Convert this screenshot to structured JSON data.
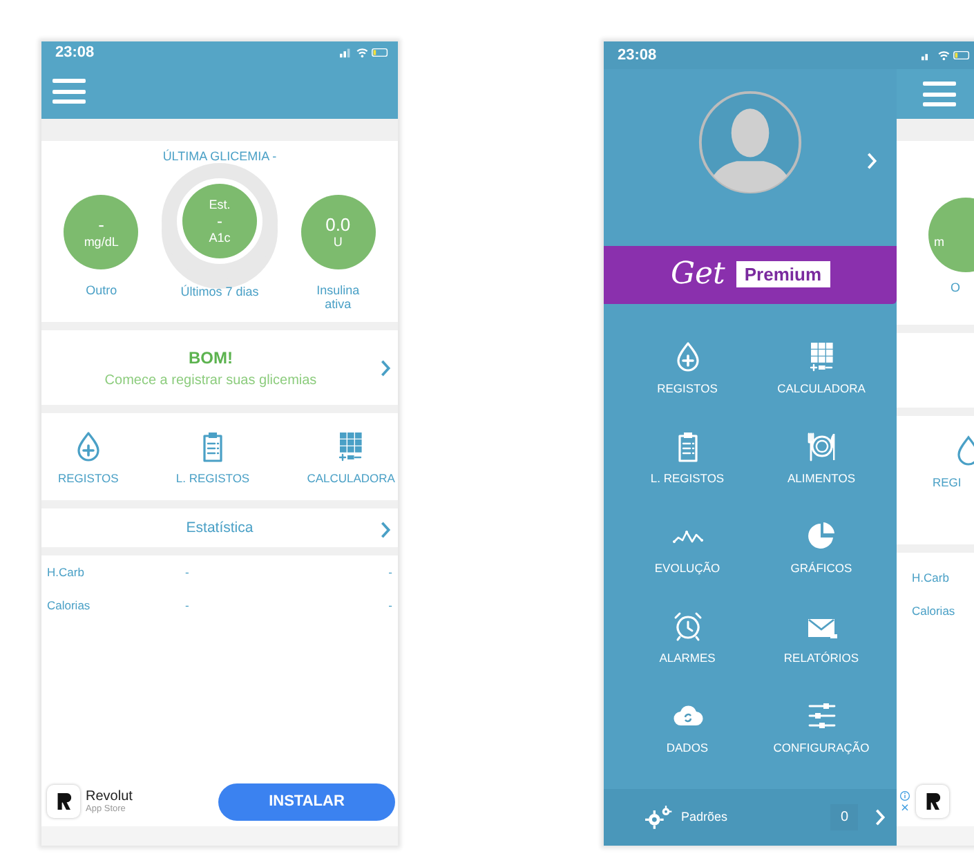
{
  "home_screen": {
    "status_bar": {
      "time": "23:08"
    },
    "last_reading": {
      "title": "ÚLTIMA GLICEMIA -"
    },
    "stats": [
      {
        "kind": "circle",
        "value": "-",
        "unit": "mg/dL",
        "label": "Outro"
      },
      {
        "kind": "ring",
        "top": "Est.",
        "value": "-",
        "unit": "A1c",
        "label": "Últimos 7 dias"
      },
      {
        "kind": "circle",
        "value": "0.0",
        "unit": "U",
        "label": "Insulina ativa"
      }
    ],
    "status_card": {
      "title": "BOM!",
      "subtitle": "Comece a registrar suas glicemias"
    },
    "shortcuts": [
      {
        "kind": "drop",
        "label": "REGISTOS"
      },
      {
        "kind": "clipboard",
        "label": "L. REGISTOS"
      },
      {
        "kind": "grid",
        "label": "CALCULADORA"
      }
    ],
    "statistics": {
      "title": "Estatística",
      "rows": [
        {
          "label": "H.Carb",
          "values": [
            "-",
            "-"
          ]
        },
        {
          "label": "Calorias",
          "values": [
            "-",
            "-"
          ]
        }
      ]
    },
    "ad": {
      "app": "Revolut",
      "store": "App Store",
      "button": "INSTALAR"
    }
  },
  "menu_screen": {
    "status_bar": {
      "time": "23:08"
    },
    "premium": {
      "script": "Get",
      "badge": "Premium"
    },
    "items": [
      {
        "kind": "drop",
        "label": "REGISTOS"
      },
      {
        "kind": "grid",
        "label": "CALCULADORA"
      },
      {
        "kind": "clipboard",
        "label": "L. REGISTOS"
      },
      {
        "kind": "plate",
        "label": "ALIMENTOS"
      },
      {
        "kind": "graph",
        "label": "EVOLUÇÃO"
      },
      {
        "kind": "pie",
        "label": "GRÁFICOS"
      },
      {
        "kind": "alarm",
        "label": "ALARMES"
      },
      {
        "kind": "mail",
        "label": "RELATÓRIOS"
      },
      {
        "kind": "cloud",
        "label": "DADOS"
      },
      {
        "kind": "sliders",
        "label": "CONFIGURAÇÃO"
      }
    ],
    "footer": {
      "label": "Padrões",
      "count": "0"
    },
    "behind": {
      "circle_unit": "m",
      "circle_label": "O",
      "shortcut_label": "REGI",
      "rows": [
        "H.Carb",
        "Calorias"
      ]
    }
  }
}
